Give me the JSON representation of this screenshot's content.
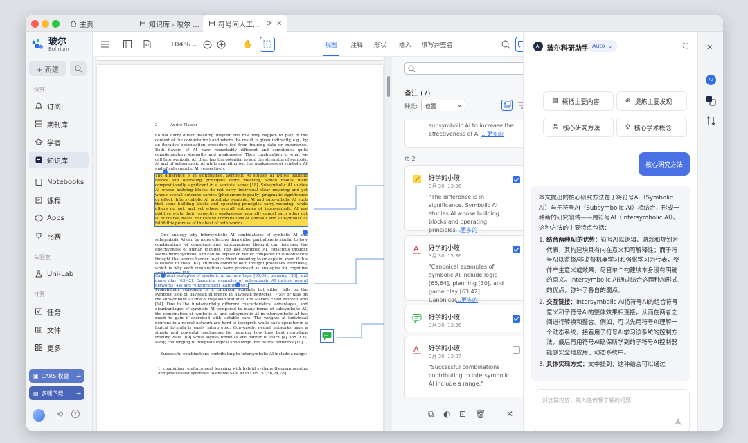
{
  "tabs": [
    {
      "label": "主页"
    },
    {
      "label": "知识库 - 玻尔 ..."
    },
    {
      "label": "符号间人工..."
    }
  ],
  "app": {
    "name": "玻尔",
    "sub": "Bohrium"
  },
  "sidebar": {
    "new_label": "+ 新建",
    "section_discover": "探究",
    "section_lab": "实验室",
    "section_compute": "计算",
    "items": [
      {
        "label": "订阅"
      },
      {
        "label": "期刊库"
      },
      {
        "label": "学者"
      },
      {
        "label": "知识库"
      },
      {
        "label": "Notebooks"
      },
      {
        "label": "课程"
      },
      {
        "label": "Apps"
      },
      {
        "label": "比赛"
      },
      {
        "label": "Uni-Lab"
      },
      {
        "label": "任务"
      },
      {
        "label": "文件"
      },
      {
        "label": "更多"
      }
    ],
    "promo1": "CARSI权益",
    "promo2": "多端下载"
  },
  "toolbar": {
    "zoom": "104%",
    "modes": [
      {
        "label": "视图"
      },
      {
        "label": "注释"
      },
      {
        "label": "形状"
      },
      {
        "label": "插入"
      },
      {
        "label": "填写并签名"
      }
    ],
    "notes_label": "备注"
  },
  "doc": {
    "page_num": "2",
    "author": "André Platzer",
    "p1": "do not carry direct meaning (beyond the role they happen to play in the context of the computation) and where the result is given indirectly, e.g., by an iterative optimization procedure fed from training data or experience. Both flavors of AI have remarkably different and sometimes quite complementary strengths and weaknesses. Their combination in what we call Intersymbolic AI, thus, has the potential to add the strengths of symbolic AI and of subsymbolic AI while canceling out the weaknesses of symbolic AI and of subsymbolic AI, respectively.",
    "hl": "The difference is in significance. Symbolic AI studies AI whose building blocks and operating principles carry meaning, which makes them compositionally significant in a semiotic sense [18]. Subsymbolic AI studies AI whose building blocks do not carry individual clear meaning and yet whose overall outcome carries (phenomenologically) pragmatic significance or effect. Intersymbolic AI interlinks symbolic AI and subsymbolic AI such that some building blocks and operating principles carry meaning, while others do not, and yet whose overall outcomes of intersymbolic AI are additive while their respective weaknesses naturally cancel each other out is, of course, naïve. But careful combinations of symbolic and subsymbolic AI fulfill this promise of the best of both worlds.",
    "p2": "One analogy why Intersymbolic AI combinations of symbolic AI and subsymbolic AI can be more effective than either part alone is similar to how combinations of conscious and subconscious thought can increase the effectiveness of human thought. Just like symbolic AI, conscious thought seems more symbolic and can be explained better compared to subconscious thought that seems harder to give direct meaning to or explain, even if this is elusive to know [61]. Humans combine both thought processes effectively, which is why such combinations were proposed as analogies for cognitive architectures [58].",
    "boxed": "Canonical examples of symbolic AI include logic [65,64], planning [30], and game play [63,42]. Canonical examples of subsymbolic AI include neural networks [44] and reinforcement learning [69].",
    "p3": "Probabilistic reasoning is a canonical example but either falls on the symbolic side of Bayesian inference in Bayesian networks [7,59] or falls on the subsymbolic AI side of Bayesian statistics and Markov chain Monte Carlo [14]. Due to the fundamentally different characteristics, advantages, and disadvantages of symbolic AI compared to many forms of subsymbolic AI, the combination of symbolic AI and subsymbolic AI in intersymbolic AI has much to gain if exercised with suitable care. The weights at individual neurons in a neural network are hard to interpret, while each operator in a logical formula is easily interpreted. Conversely, neural networks have a simple and powerful mechanism for learning how they best reproduce training data [69] while logical formulas are harder to learn [4] and it is, sadly, challenging to integrate logical knowledge into neural networks [10].",
    "ul": "Successful combinations contributing to Intersymbolic AI include a range:",
    "li": "1. combining reinforcement learning with hybrid systems theorem proving and proof-based synthesis to enable Safe AI in CPS [57,56,24,78]."
  },
  "notes": {
    "title": "备注 (7)",
    "filter_label": "种类:",
    "filter_value": "位置",
    "top_snippet": "subsymbolic AI to increase the effectiveness of AI",
    "more": "...更多的",
    "page_label": "页 2",
    "cards": [
      {
        "user": "好学的小玻",
        "time": "3月 30, 13:36",
        "text": "\"The difference is in significance. Symbolic AI studies AI whose building blocks and operating principles",
        "checked": true
      },
      {
        "user": "好学的小玻",
        "time": "3月 30, 13:36",
        "text": "\"Canonical examples of symbolic AI include logic [65,64], planning [30], and game play [63,42]. Canonical",
        "checked": true
      },
      {
        "user": "好学的小玻",
        "time": "3月 30, 13:36",
        "text": "",
        "checked": true
      },
      {
        "user": "好学的小玻",
        "time": "3月 30, 13:37",
        "text": "\"Successful combinations contributing to Intersymbolic AI include a range:\"",
        "checked": false
      }
    ]
  },
  "ai": {
    "title": "玻尔科研助手",
    "mode": "Auto",
    "buttons": [
      {
        "label": "概括主要内容"
      },
      {
        "label": "提炼主要发现"
      },
      {
        "label": "核心研究方法"
      },
      {
        "label": "核心学术概念"
      }
    ],
    "chip": "核心研究方法",
    "intro": "本文提出的核心研究方法在于将符号AI（Symbolic AI）与子符号AI（Subsymbolic AI）相结合，形成一种新的研究领域——跨符号AI（Intersymbolic AI）。这种方法的主要特点包括：",
    "points": [
      {
        "head": "结合两种AI的优势：",
        "body": "符号AI以逻辑、游戏和规划为代表，其构建块具有内在意义和可解释性；而子符号AI以监督/非监督机器学习和强化学习为代表，整体产生意义或效果，尽管单个构建块本身没有明确的意义。Intersymbolic AI通过结合这两种AI形式的优点，弥补了各自的弱点。"
      },
      {
        "head": "交互链接：",
        "body": "Intersymbolic AI将符号AI的组合符号意义和子符号AI的整体效果相连接，从而在两者之间进行转换和整合。例如，可以先用符号AI理解一个动态系统，接着用子符号AI学习该系统的控制方法，最后再用符号AI确保所学到的子符号AI控制器能够安全地应用于动态系统中。"
      },
      {
        "head": "具体实现方式：",
        "body": "文中提到，这种结合可以通过"
      }
    ],
    "input_placeholder": "对这篇内容，输入任何想了解的问题"
  },
  "colors": {
    "accent": "#2f6fe6",
    "highlight": "#fbd94a"
  }
}
